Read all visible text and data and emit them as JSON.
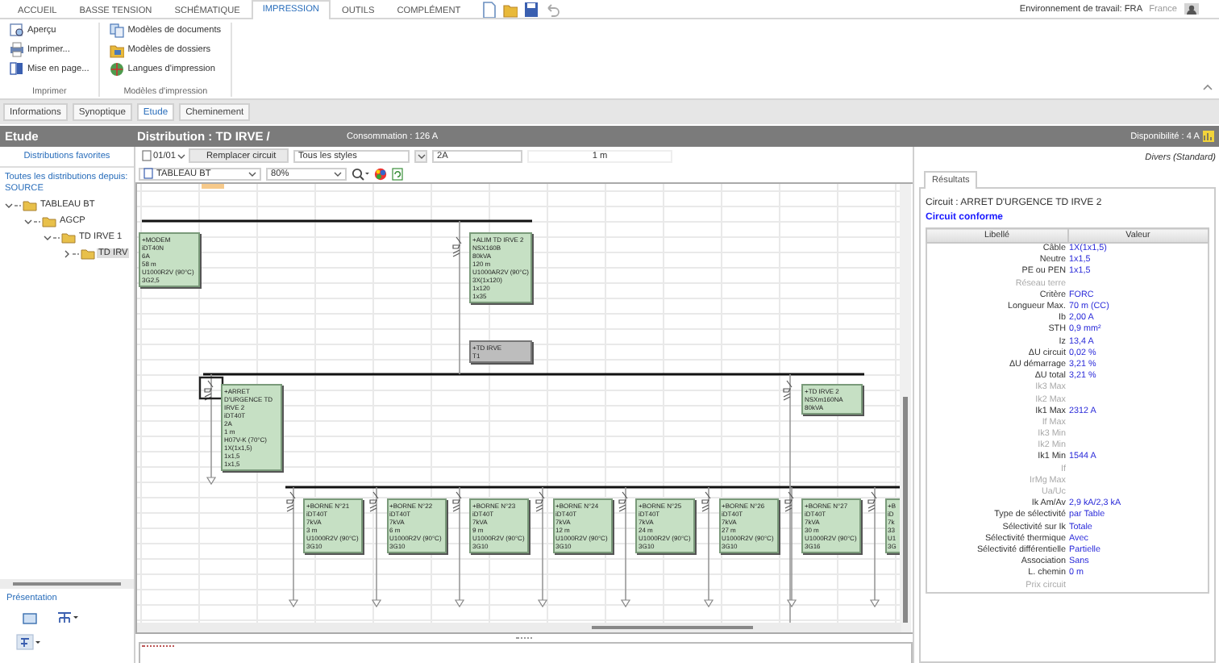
{
  "ribbon_tabs": [
    {
      "label": "ACCUEIL",
      "selected": false
    },
    {
      "label": "BASSE TENSION",
      "selected": false
    },
    {
      "label": "SCHÉMATIQUE",
      "selected": false
    },
    {
      "label": "IMPRESSION",
      "selected": true
    },
    {
      "label": "OUTILS",
      "selected": false
    },
    {
      "label": "COMPLÉMENT",
      "selected": false
    }
  ],
  "workspace": {
    "label": "Environnement de travail: FRA",
    "country": "France"
  },
  "ribbon_groups": [
    {
      "title": "Imprimer",
      "buttons": [
        "Aperçu",
        "Imprimer...",
        "Mise en page..."
      ]
    },
    {
      "title": "Modèles d'impression",
      "buttons": [
        "Modèles de documents",
        "Modèles de dossiers",
        "Langues d'impression"
      ]
    }
  ],
  "view_tabs": [
    {
      "label": "Informations",
      "selected": false
    },
    {
      "label": "Synoptique",
      "selected": false
    },
    {
      "label": "Etude",
      "selected": true
    },
    {
      "label": "Cheminement",
      "selected": false
    }
  ],
  "header": {
    "section": "Etude",
    "title": "Distribution : TD IRVE /",
    "consumption": "Consommation : 126 A",
    "availability": "Disponibilité : 4 A"
  },
  "sidebar": {
    "favorites": "Distributions favorites",
    "all_link": "Toutes les distributions depuis: SOURCE",
    "presentation_title": "Présentation",
    "tree": [
      {
        "label": "TABLEAU BT",
        "expanded": true,
        "selected": false,
        "children": [
          {
            "label": "AGCP",
            "expanded": true,
            "selected": false,
            "children": [
              {
                "label": "TD IRVE 1",
                "expanded": true,
                "selected": false,
                "children": [
                  {
                    "label": "TD IRV",
                    "expanded": false,
                    "selected": true
                  }
                ]
              }
            ]
          }
        ]
      }
    ]
  },
  "toolbar": {
    "page": "01/01",
    "replace_button": "Remplacer circuit",
    "style_filter": "Tous les styles",
    "current": "2A",
    "length": "1 m",
    "board": "TABLEAU BT",
    "zoom": "80%",
    "misc": "Divers (Standard)"
  },
  "diagram": {
    "level_1": [
      {
        "lines": [
          "+MODEM",
          "iDT40N",
          "6A",
          "58 m",
          "U1000R2V (90°C)",
          "3G2,5"
        ]
      },
      {
        "lines": [
          "+ALIM TD IRVE 2",
          "NSX160B",
          "80kVA",
          "120 m",
          "U1000AR2V (90°C)",
          "3X(1x120)",
          "1x120",
          "1x35"
        ]
      }
    ],
    "board_marker": {
      "lines": [
        "+TD IRVE",
        "T1"
      ]
    },
    "level_2": [
      {
        "selected": true,
        "lines": [
          "+ARRET",
          "D'URGENCE TD",
          "IRVE 2",
          "iDT40T",
          "2A",
          "1 m",
          "H07V-K (70°C)",
          "1X(1x1,5)",
          "1x1,5",
          "1x1,5"
        ]
      },
      {
        "selected": false,
        "lines": [
          "+TD IRVE 2",
          "NSXm160NA",
          "80kVA"
        ]
      }
    ],
    "level_3": [
      {
        "lines": [
          "+BORNE N°21",
          "iDT40T",
          "7kVA",
          "3 m",
          "U1000R2V (90°C)",
          "3G10"
        ]
      },
      {
        "lines": [
          "+BORNE N°22",
          "iDT40T",
          "7kVA",
          "6 m",
          "U1000R2V (90°C)",
          "3G10"
        ]
      },
      {
        "lines": [
          "+BORNE N°23",
          "iDT40T",
          "7kVA",
          "9 m",
          "U1000R2V (90°C)",
          "3G10"
        ]
      },
      {
        "lines": [
          "+BORNE N°24",
          "iDT40T",
          "7kVA",
          "12 m",
          "U1000R2V (90°C)",
          "3G10"
        ]
      },
      {
        "lines": [
          "+BORNE N°25",
          "iDT40T",
          "7kVA",
          "24 m",
          "U1000R2V (90°C)",
          "3G10"
        ]
      },
      {
        "lines": [
          "+BORNE N°26",
          "iDT40T",
          "7kVA",
          "27 m",
          "U1000R2V (90°C)",
          "3G10"
        ]
      },
      {
        "lines": [
          "+BORNE N°27",
          "iDT40T",
          "7kVA",
          "30 m",
          "U1000R2V (90°C)",
          "3G16"
        ]
      },
      {
        "lines": [
          "+B",
          "iD",
          "7k",
          "33",
          "U1",
          "3G"
        ]
      }
    ]
  },
  "results": {
    "tab": "Résultats",
    "circuit": "Circuit : ARRET D'URGENCE TD IRVE 2",
    "status": "Circuit conforme",
    "columns": [
      "Libellé",
      "Valeur"
    ],
    "rows": [
      {
        "label": "Câble",
        "value": "1X(1x1,5)",
        "dimmed": false
      },
      {
        "label": "Neutre",
        "value": "1x1,5",
        "dimmed": false
      },
      {
        "label": "PE ou PEN",
        "value": "1x1,5",
        "dimmed": false
      },
      {
        "label": "Réseau terre",
        "dimmed": true
      },
      {
        "label": "Critère",
        "value": "FORC",
        "dimmed": false
      },
      {
        "label": "Longueur Max.",
        "value": "70 m (CC)",
        "dimmed": false
      },
      {
        "label": "Ib",
        "value": "2,00 A",
        "dimmed": false
      },
      {
        "label": "STH",
        "value": "0,9 mm²",
        "dimmed": false
      },
      {
        "label": "Iz",
        "value": "13,4 A",
        "dimmed": false
      },
      {
        "label": "ΔU circuit",
        "value": "0,02 %",
        "dimmed": false
      },
      {
        "label": "ΔU démarrage",
        "value": "3,21 %",
        "dimmed": false
      },
      {
        "label": "ΔU total",
        "value": "3,21 %",
        "dimmed": false
      },
      {
        "label": "Ik3 Max",
        "dimmed": true
      },
      {
        "label": "Ik2 Max",
        "dimmed": true
      },
      {
        "label": "Ik1 Max",
        "value": "2312 A",
        "dimmed": false
      },
      {
        "label": "If Max",
        "dimmed": true
      },
      {
        "label": "Ik3 Min",
        "dimmed": true
      },
      {
        "label": "Ik2 Min",
        "dimmed": true
      },
      {
        "label": "Ik1 Min",
        "value": "1544 A",
        "dimmed": false
      },
      {
        "label": "If",
        "dimmed": true
      },
      {
        "label": "IrMg Max",
        "dimmed": true
      },
      {
        "label": "Ua/Uc",
        "dimmed": true
      },
      {
        "label": "Ik Am/Av",
        "value": "2,9 kA/2,3 kA",
        "dimmed": false
      },
      {
        "label": "Type de sélectivité",
        "value": "par Table",
        "dimmed": false
      },
      {
        "label": "Sélectivité sur Ik",
        "value": "Totale",
        "dimmed": false
      },
      {
        "label": "Sélectivité thermique",
        "value": "Avec",
        "dimmed": false
      },
      {
        "label": "Sélectivité différentielle",
        "value": "Partielle",
        "dimmed": false
      },
      {
        "label": "Association",
        "value": "Sans",
        "dimmed": false
      },
      {
        "label": "L. chemin",
        "value": "0 m",
        "dimmed": false
      },
      {
        "label": "Prix circuit",
        "dimmed": true
      }
    ]
  }
}
